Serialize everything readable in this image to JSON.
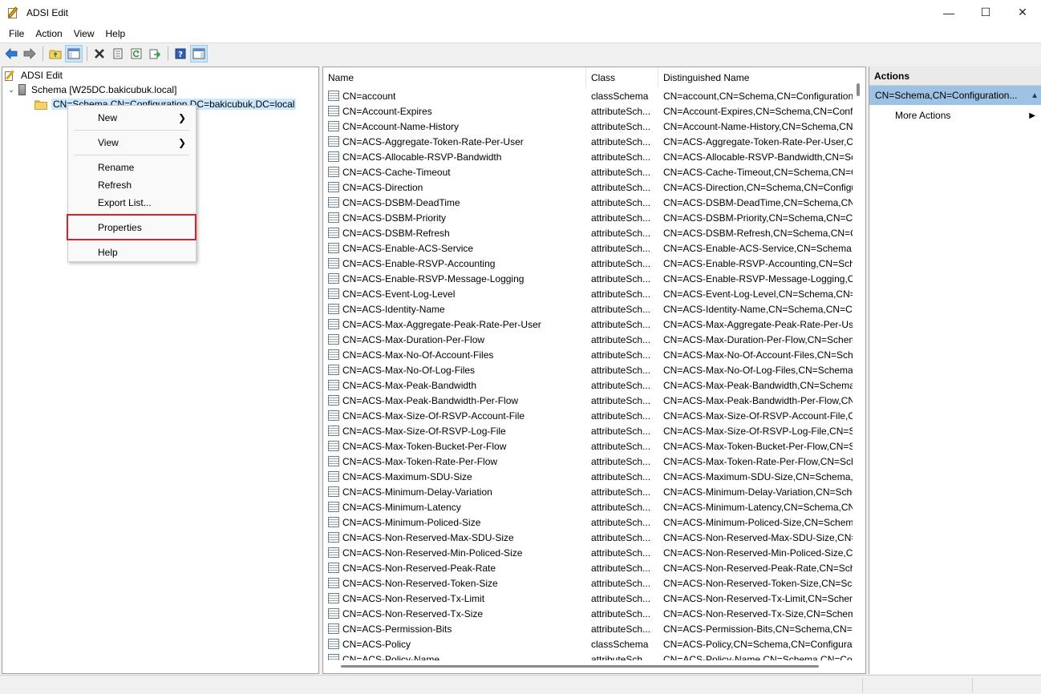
{
  "window": {
    "title": "ADSI Edit",
    "min": "—",
    "max": "☐",
    "close": "✕"
  },
  "menubar": [
    "File",
    "Action",
    "View",
    "Help"
  ],
  "toolbar": [
    "back-icon",
    "forward-icon",
    "up-folder-icon",
    "show-hide-tree-icon",
    "delete-icon",
    "properties-icon",
    "refresh-icon",
    "export-icon",
    "help-icon",
    "show-hide-action-pane-icon"
  ],
  "tree": {
    "root": "ADSI Edit",
    "schema": "Schema [W25DC.bakicubuk.local]",
    "node": "CN=Schema,CN=Configuration,DC=bakicubuk,DC=local"
  },
  "context_menu": {
    "new": "New",
    "view": "View",
    "rename": "Rename",
    "refresh": "Refresh",
    "export": "Export List...",
    "properties": "Properties",
    "help": "Help"
  },
  "list": {
    "columns": [
      "Name",
      "Class",
      "Distinguished Name"
    ],
    "rows": [
      [
        "CN=account",
        "classSchema",
        "CN=account,CN=Schema,CN=Configuration,DC=bakicubuk,DC=local"
      ],
      [
        "CN=Account-Expires",
        "attributeSch...",
        "CN=Account-Expires,CN=Schema,CN=Configuration,DC=bakicubuk,DC=local"
      ],
      [
        "CN=Account-Name-History",
        "attributeSch...",
        "CN=Account-Name-History,CN=Schema,CN=Configuration,DC=bakicubuk,DC=local"
      ],
      [
        "CN=ACS-Aggregate-Token-Rate-Per-User",
        "attributeSch...",
        "CN=ACS-Aggregate-Token-Rate-Per-User,CN=Schema,CN=Configuration,DC=bakicubuk,DC=local"
      ],
      [
        "CN=ACS-Allocable-RSVP-Bandwidth",
        "attributeSch...",
        "CN=ACS-Allocable-RSVP-Bandwidth,CN=Schema,CN=Configuration,DC=bakicubuk,DC=local"
      ],
      [
        "CN=ACS-Cache-Timeout",
        "attributeSch...",
        "CN=ACS-Cache-Timeout,CN=Schema,CN=Configuration,DC=bakicubuk,DC=local"
      ],
      [
        "CN=ACS-Direction",
        "attributeSch...",
        "CN=ACS-Direction,CN=Schema,CN=Configuration,DC=bakicubuk,DC=local"
      ],
      [
        "CN=ACS-DSBM-DeadTime",
        "attributeSch...",
        "CN=ACS-DSBM-DeadTime,CN=Schema,CN=Configuration,DC=bakicubuk,DC=local"
      ],
      [
        "CN=ACS-DSBM-Priority",
        "attributeSch...",
        "CN=ACS-DSBM-Priority,CN=Schema,CN=Configuration,DC=bakicubuk,DC=local"
      ],
      [
        "CN=ACS-DSBM-Refresh",
        "attributeSch...",
        "CN=ACS-DSBM-Refresh,CN=Schema,CN=Configuration,DC=bakicubuk,DC=local"
      ],
      [
        "CN=ACS-Enable-ACS-Service",
        "attributeSch...",
        "CN=ACS-Enable-ACS-Service,CN=Schema,CN=Configuration,DC=bakicubuk,DC=local"
      ],
      [
        "CN=ACS-Enable-RSVP-Accounting",
        "attributeSch...",
        "CN=ACS-Enable-RSVP-Accounting,CN=Schema,CN=Configuration,DC=bakicubuk,DC=local"
      ],
      [
        "CN=ACS-Enable-RSVP-Message-Logging",
        "attributeSch...",
        "CN=ACS-Enable-RSVP-Message-Logging,CN=Schema,CN=Configuration,DC=bakicubuk,DC=local"
      ],
      [
        "CN=ACS-Event-Log-Level",
        "attributeSch...",
        "CN=ACS-Event-Log-Level,CN=Schema,CN=Configuration,DC=bakicubuk,DC=local"
      ],
      [
        "CN=ACS-Identity-Name",
        "attributeSch...",
        "CN=ACS-Identity-Name,CN=Schema,CN=Configuration,DC=bakicubuk,DC=local"
      ],
      [
        "CN=ACS-Max-Aggregate-Peak-Rate-Per-User",
        "attributeSch...",
        "CN=ACS-Max-Aggregate-Peak-Rate-Per-User,CN=Schema,CN=Configuration,DC=bakicubuk,DC=local"
      ],
      [
        "CN=ACS-Max-Duration-Per-Flow",
        "attributeSch...",
        "CN=ACS-Max-Duration-Per-Flow,CN=Schema,CN=Configuration,DC=bakicubuk,DC=local"
      ],
      [
        "CN=ACS-Max-No-Of-Account-Files",
        "attributeSch...",
        "CN=ACS-Max-No-Of-Account-Files,CN=Schema,CN=Configuration,DC=bakicubuk,DC=local"
      ],
      [
        "CN=ACS-Max-No-Of-Log-Files",
        "attributeSch...",
        "CN=ACS-Max-No-Of-Log-Files,CN=Schema,CN=Configuration,DC=bakicubuk,DC=local"
      ],
      [
        "CN=ACS-Max-Peak-Bandwidth",
        "attributeSch...",
        "CN=ACS-Max-Peak-Bandwidth,CN=Schema,CN=Configuration,DC=bakicubuk,DC=local"
      ],
      [
        "CN=ACS-Max-Peak-Bandwidth-Per-Flow",
        "attributeSch...",
        "CN=ACS-Max-Peak-Bandwidth-Per-Flow,CN=Schema,CN=Configuration,DC=bakicubuk,DC=local"
      ],
      [
        "CN=ACS-Max-Size-Of-RSVP-Account-File",
        "attributeSch...",
        "CN=ACS-Max-Size-Of-RSVP-Account-File,CN=Schema,CN=Configuration,DC=bakicubuk,DC=local"
      ],
      [
        "CN=ACS-Max-Size-Of-RSVP-Log-File",
        "attributeSch...",
        "CN=ACS-Max-Size-Of-RSVP-Log-File,CN=Schema,CN=Configuration,DC=bakicubuk,DC=local"
      ],
      [
        "CN=ACS-Max-Token-Bucket-Per-Flow",
        "attributeSch...",
        "CN=ACS-Max-Token-Bucket-Per-Flow,CN=Schema,CN=Configuration,DC=bakicubuk,DC=local"
      ],
      [
        "CN=ACS-Max-Token-Rate-Per-Flow",
        "attributeSch...",
        "CN=ACS-Max-Token-Rate-Per-Flow,CN=Schema,CN=Configuration,DC=bakicubuk,DC=local"
      ],
      [
        "CN=ACS-Maximum-SDU-Size",
        "attributeSch...",
        "CN=ACS-Maximum-SDU-Size,CN=Schema,CN=Configuration,DC=bakicubuk,DC=local"
      ],
      [
        "CN=ACS-Minimum-Delay-Variation",
        "attributeSch...",
        "CN=ACS-Minimum-Delay-Variation,CN=Schema,CN=Configuration,DC=bakicubuk,DC=local"
      ],
      [
        "CN=ACS-Minimum-Latency",
        "attributeSch...",
        "CN=ACS-Minimum-Latency,CN=Schema,CN=Configuration,DC=bakicubuk,DC=local"
      ],
      [
        "CN=ACS-Minimum-Policed-Size",
        "attributeSch...",
        "CN=ACS-Minimum-Policed-Size,CN=Schema,CN=Configuration,DC=bakicubuk,DC=local"
      ],
      [
        "CN=ACS-Non-Reserved-Max-SDU-Size",
        "attributeSch...",
        "CN=ACS-Non-Reserved-Max-SDU-Size,CN=Schema,CN=Configuration,DC=bakicubuk,DC=local"
      ],
      [
        "CN=ACS-Non-Reserved-Min-Policed-Size",
        "attributeSch...",
        "CN=ACS-Non-Reserved-Min-Policed-Size,CN=Schema,CN=Configuration,DC=bakicubuk,DC=local"
      ],
      [
        "CN=ACS-Non-Reserved-Peak-Rate",
        "attributeSch...",
        "CN=ACS-Non-Reserved-Peak-Rate,CN=Schema,CN=Configuration,DC=bakicubuk,DC=local"
      ],
      [
        "CN=ACS-Non-Reserved-Token-Size",
        "attributeSch...",
        "CN=ACS-Non-Reserved-Token-Size,CN=Schema,CN=Configuration,DC=bakicubuk,DC=local"
      ],
      [
        "CN=ACS-Non-Reserved-Tx-Limit",
        "attributeSch...",
        "CN=ACS-Non-Reserved-Tx-Limit,CN=Schema,CN=Configuration,DC=bakicubuk,DC=local"
      ],
      [
        "CN=ACS-Non-Reserved-Tx-Size",
        "attributeSch...",
        "CN=ACS-Non-Reserved-Tx-Size,CN=Schema,CN=Configuration,DC=bakicubuk,DC=local"
      ],
      [
        "CN=ACS-Permission-Bits",
        "attributeSch...",
        "CN=ACS-Permission-Bits,CN=Schema,CN=Configuration,DC=bakicubuk,DC=local"
      ],
      [
        "CN=ACS-Policy",
        "classSchema",
        "CN=ACS-Policy,CN=Schema,CN=Configuration,DC=bakicubuk,DC=local"
      ],
      [
        "CN=ACS-Policy-Name",
        "attributeSch...",
        "CN=ACS-Policy-Name,CN=Schema,CN=Configuration,DC=bakicubuk,DC=local"
      ]
    ]
  },
  "actions": {
    "header": "Actions",
    "selected": "CN=Schema,CN=Configuration...",
    "more": "More Actions"
  }
}
